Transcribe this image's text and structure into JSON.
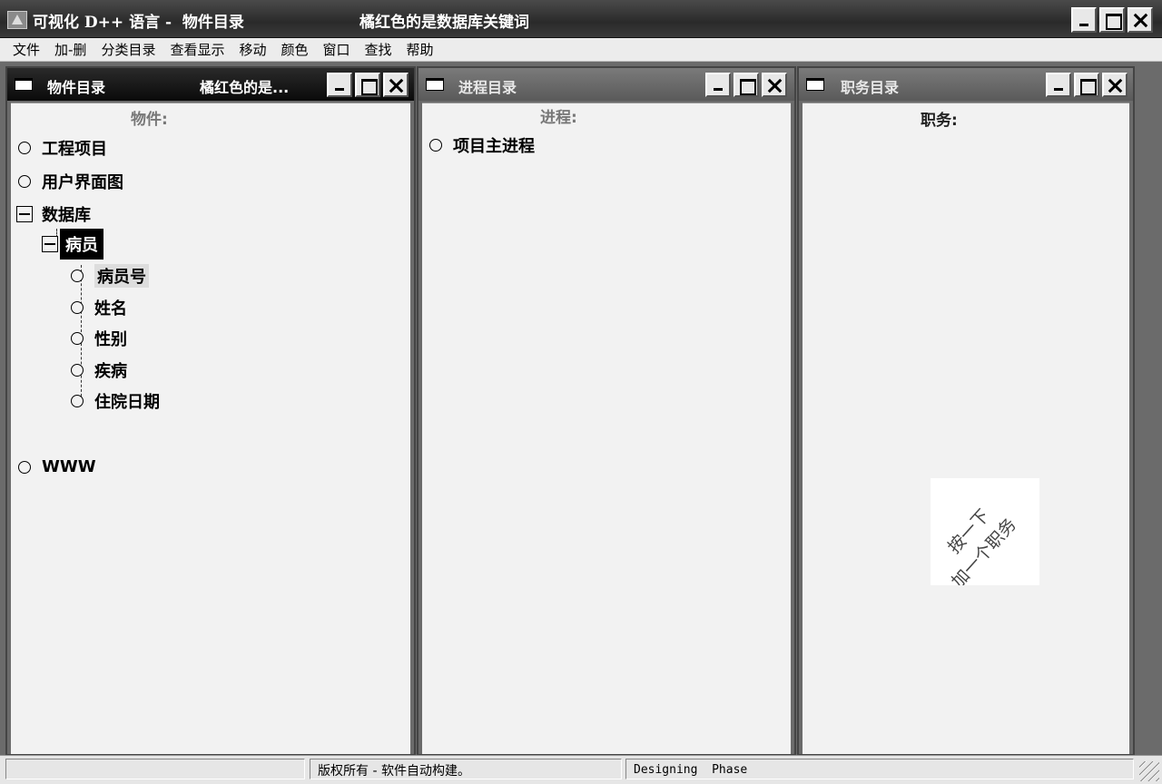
{
  "window": {
    "title": "可视化 D++ 语言 -  物件目录",
    "subtitle": "橘红色的是数据库关键词"
  },
  "menu": [
    "文件",
    "加-删",
    "分类目录",
    "查看显示",
    "移动",
    "颜色",
    "窗口",
    "查找",
    "帮助"
  ],
  "object_window": {
    "title": "物件目录",
    "subtitle": "橘红色的是...",
    "heading": "物件:",
    "items": {
      "project": "工程项目",
      "ui_diagram": "用户界面图",
      "database": "数据库",
      "table": "病员",
      "fields": [
        "病员号",
        "姓名",
        "性别",
        "疾病",
        "住院日期"
      ],
      "www": "WWW"
    }
  },
  "process_window": {
    "title": "进程目录",
    "heading": "进程:",
    "items": [
      "项目主进程"
    ]
  },
  "duty_window": {
    "title": "职务目录",
    "heading": "职务:",
    "note": [
      "按一下",
      "加一个职务"
    ]
  },
  "status": {
    "pane1": "",
    "pane2": "版权所有 - 软件自动构建。",
    "pane3": "Designing  Phase"
  }
}
